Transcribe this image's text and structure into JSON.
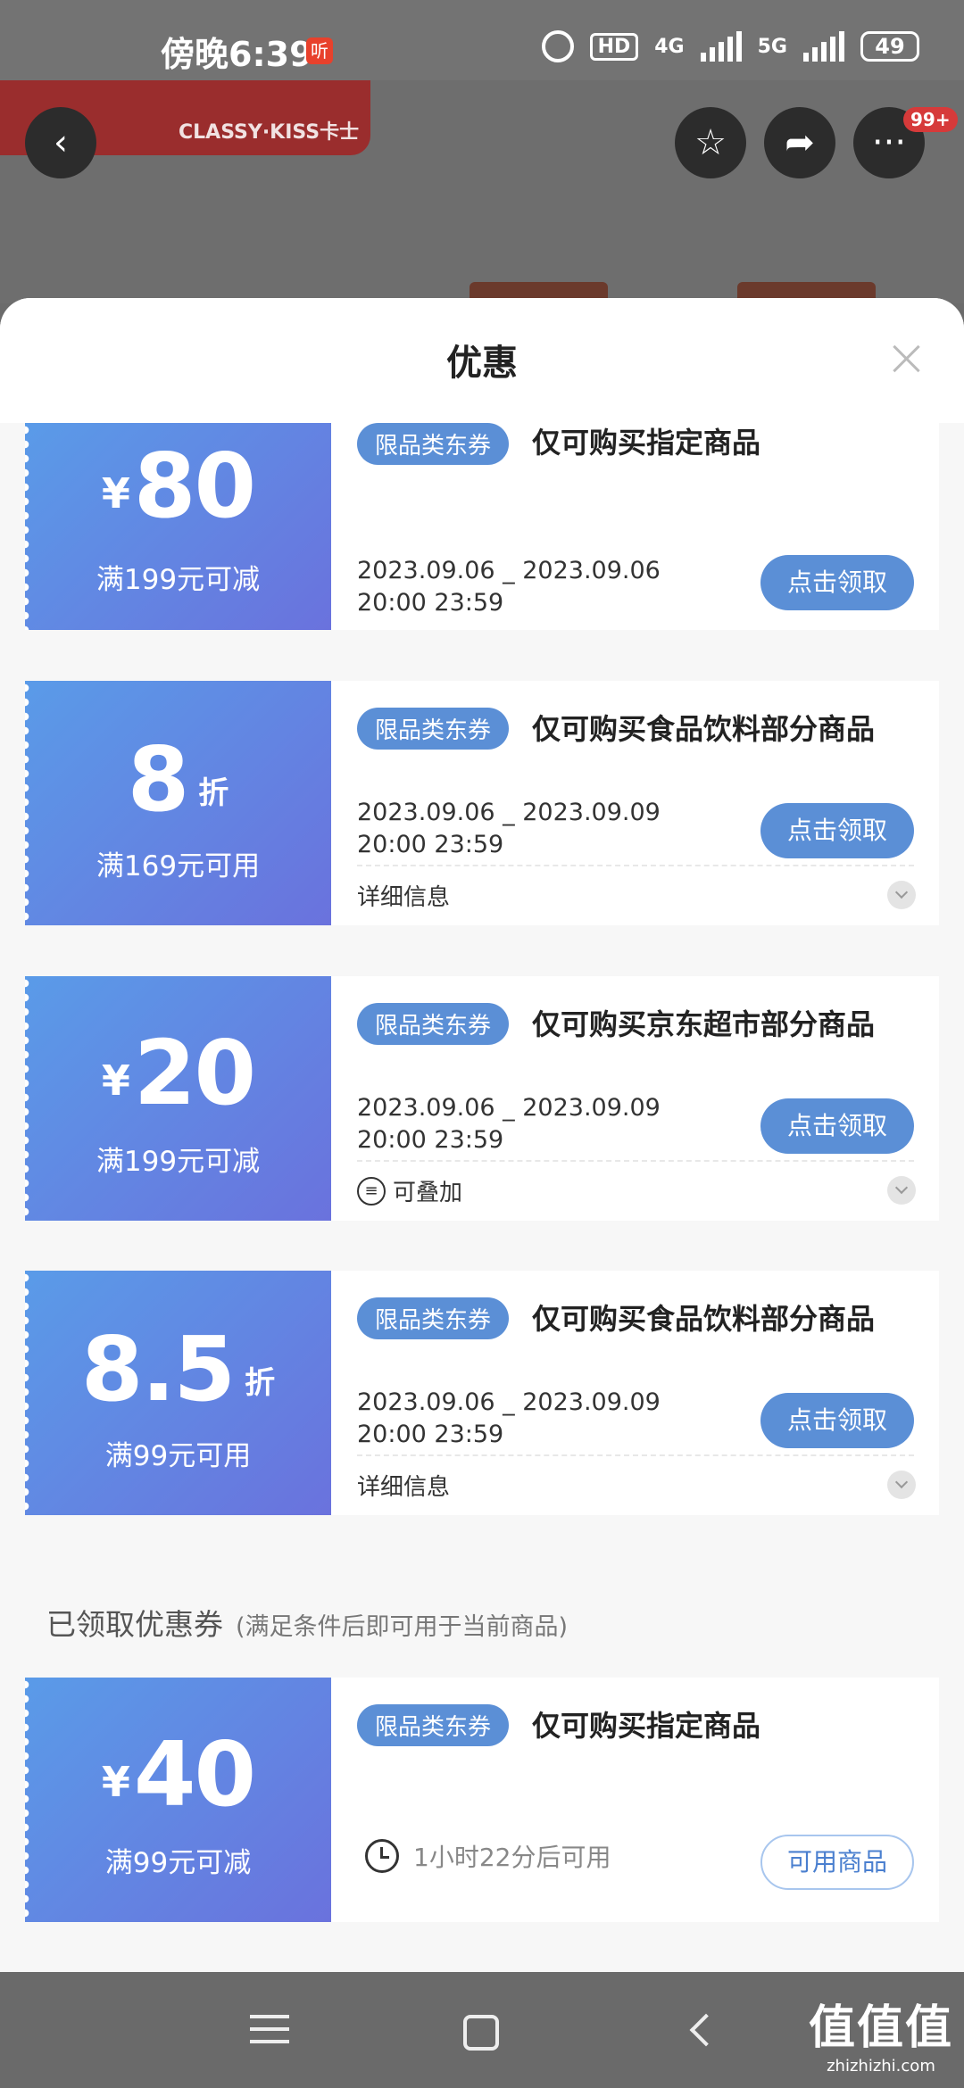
{
  "status_bar": {
    "time": "傍晚6:39",
    "badge": "听",
    "hd": "HD",
    "net1": "4G",
    "net2": "5G",
    "battery": "49"
  },
  "background": {
    "banner_text": "CLASSY·KISS卡士",
    "back_icon": "back-arrow-icon",
    "more_badge": "99+"
  },
  "sheet": {
    "title": "优惠",
    "close_icon": "close-icon"
  },
  "coupons": [
    {
      "currency": "¥",
      "amount": "80",
      "unit": "",
      "condition": "满199元可减",
      "tag": "限品类东券",
      "desc": "仅可购买指定商品",
      "date_line1": "2023.09.06 _ 2023.09.06",
      "date_line2": "20:00 23:59",
      "button": "点击领取",
      "footer": ""
    },
    {
      "currency": "",
      "amount": "8",
      "unit": "折",
      "condition": "满169元可用",
      "tag": "限品类东券",
      "desc": "仅可购买食品饮料部分商品",
      "date_line1": "2023.09.06 _ 2023.09.09",
      "date_line2": "20:00 23:59",
      "button": "点击领取",
      "footer": "详细信息"
    },
    {
      "currency": "¥",
      "amount": "20",
      "unit": "",
      "condition": "满199元可减",
      "tag": "限品类东券",
      "desc": "仅可购买京东超市部分商品",
      "date_line1": "2023.09.06 _ 2023.09.09",
      "date_line2": "20:00 23:59",
      "button": "点击领取",
      "footer": "可叠加"
    },
    {
      "currency": "",
      "amount": "8.5",
      "unit": "折",
      "condition": "满99元可用",
      "tag": "限品类东券",
      "desc": "仅可购买食品饮料部分商品",
      "date_line1": "2023.09.06 _ 2023.09.09",
      "date_line2": "20:00 23:59",
      "button": "点击领取",
      "footer": "详细信息"
    }
  ],
  "claimed_section": {
    "title": "已领取优惠券",
    "subtitle": "(满足条件后即可用于当前商品)"
  },
  "claimed_coupon": {
    "currency": "¥",
    "amount": "40",
    "condition": "满99元可减",
    "tag": "限品类东券",
    "desc": "仅可购买指定商品",
    "wait_text": "1小时22分后可用",
    "button": "可用商品"
  },
  "watermark": {
    "main": "值值值",
    "sub": "zhizhizhi.com"
  },
  "colors": {
    "coupon_gradient_start": "#5a9be8",
    "coupon_gradient_end": "#6a72dd",
    "button_blue": "#5b8fd6"
  }
}
